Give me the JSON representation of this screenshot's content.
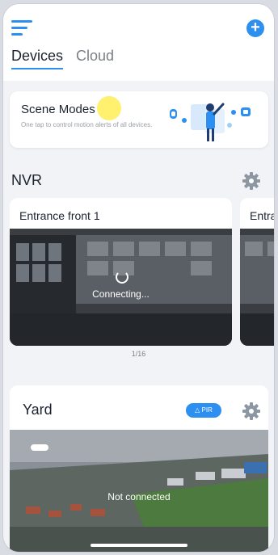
{
  "header": {
    "menu_icon": "hamburger-menu-icon",
    "add_icon": "plus-icon",
    "accent_color": "#2d8ff0",
    "tabs": [
      {
        "label": "Devices",
        "active": true
      },
      {
        "label": "Cloud",
        "active": false
      }
    ]
  },
  "scene_card": {
    "title": "Scene Modes",
    "description": "One tap to control motion alerts of all devices."
  },
  "nvr": {
    "title": "NVR",
    "cameras": [
      {
        "name": "Entrance front 1",
        "status": "Connecting..."
      },
      {
        "name": "Entra"
      }
    ],
    "pager": "1/16"
  },
  "yard": {
    "title": "Yard",
    "badge": "PIR",
    "status": "Not connected"
  }
}
